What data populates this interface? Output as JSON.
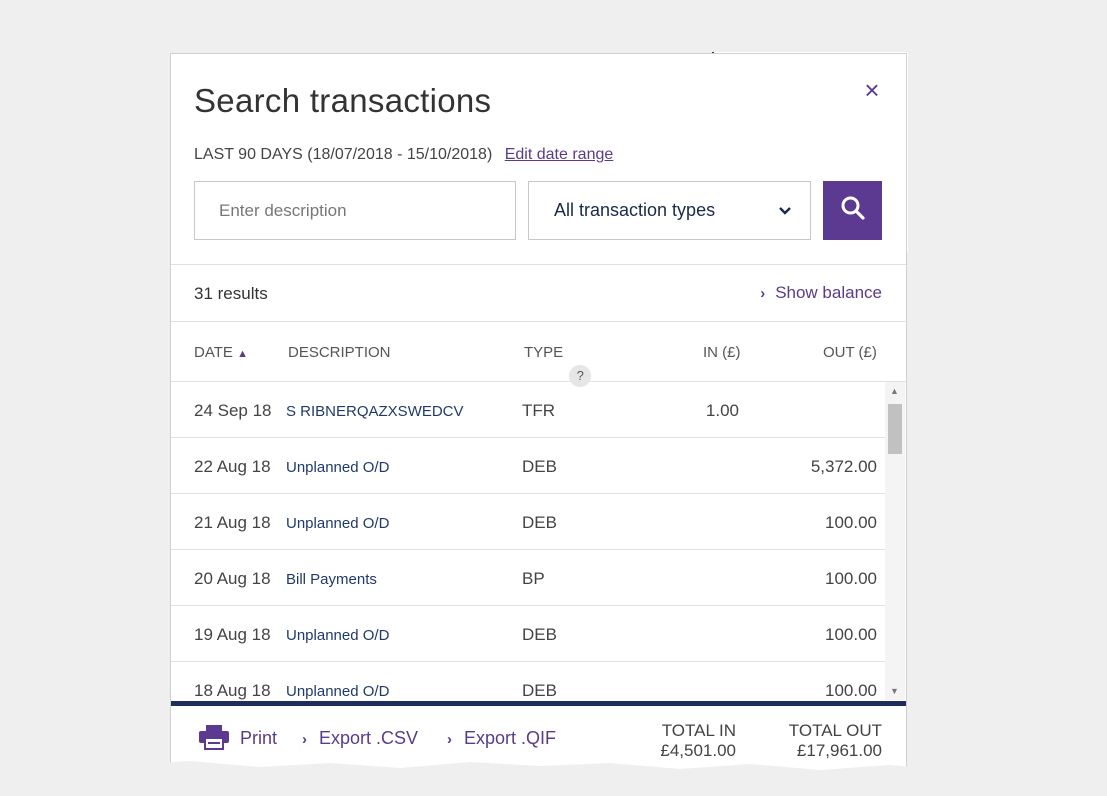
{
  "modal": {
    "title": "Search transactions",
    "close_icon": "×",
    "date_range_text": "LAST 90 DAYS (18/07/2018 - 15/10/2018)",
    "edit_date_range_label": "Edit date range"
  },
  "search": {
    "description_placeholder": "Enter description",
    "description_value": "",
    "type_selected": "All transaction types",
    "search_icon": "search-icon"
  },
  "results": {
    "count_text": "31 results",
    "show_balance_label": "Show balance"
  },
  "table": {
    "columns": {
      "date": "DATE",
      "description": "DESCRIPTION",
      "type": "TYPE",
      "type_help": "?",
      "in": "IN (£)",
      "out": "OUT (£)"
    },
    "rows": [
      {
        "date": "24 Sep 18",
        "description": "S RIBNERQAZXSWEDCV",
        "type": "TFR",
        "in": "1.00",
        "out": ""
      },
      {
        "date": "22 Aug 18",
        "description": "Unplanned O/D",
        "type": "DEB",
        "in": "",
        "out": "5,372.00"
      },
      {
        "date": "21 Aug 18",
        "description": "Unplanned O/D",
        "type": "DEB",
        "in": "",
        "out": "100.00"
      },
      {
        "date": "20 Aug 18",
        "description": "Bill Payments",
        "type": "BP",
        "in": "",
        "out": "100.00"
      },
      {
        "date": "19 Aug 18",
        "description": "Unplanned O/D",
        "type": "DEB",
        "in": "",
        "out": "100.00"
      },
      {
        "date": "18 Aug 18",
        "description": "Unplanned O/D",
        "type": "DEB",
        "in": "",
        "out": "100.00"
      }
    ]
  },
  "footer": {
    "print_label": "Print",
    "export_csv_label": "Export .CSV",
    "export_qif_label": "Export .QIF",
    "total_in_label": "TOTAL IN",
    "total_in_value": "£4,501.00",
    "total_out_label": "TOTAL OUT",
    "total_out_value": "£17,961.00"
  },
  "colors": {
    "accent": "#5c3a92",
    "navy": "#1f2d5c",
    "link": "#5a3b8c"
  }
}
